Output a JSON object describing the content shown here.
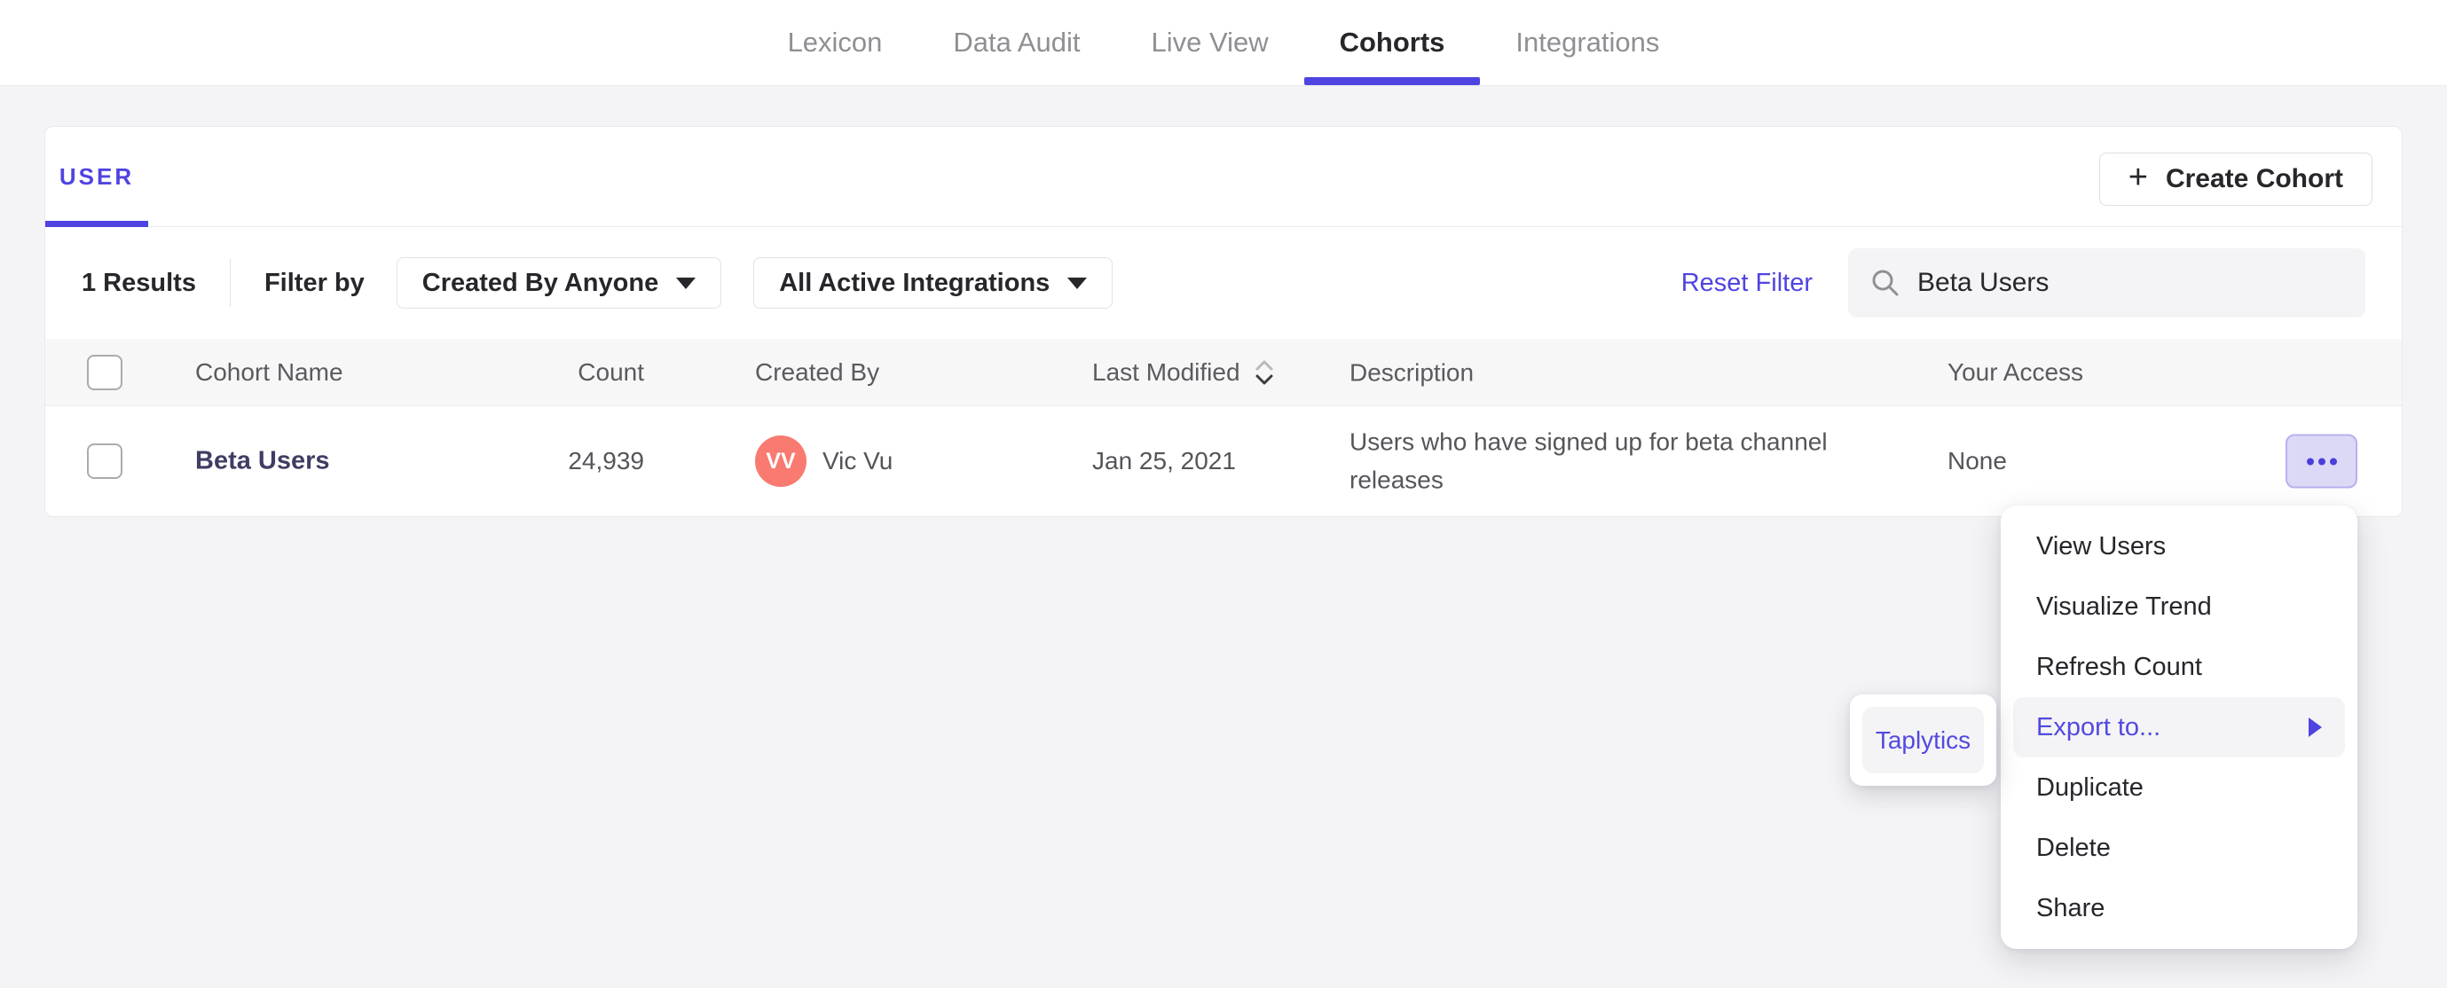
{
  "nav": {
    "items": [
      {
        "label": "Lexicon"
      },
      {
        "label": "Data Audit"
      },
      {
        "label": "Live View"
      },
      {
        "label": "Cohorts"
      },
      {
        "label": "Integrations"
      }
    ],
    "active": "Cohorts"
  },
  "panel": {
    "tab_label": "USER",
    "create_cohort": {
      "icon": "+",
      "label": "Create Cohort"
    },
    "filter_bar": {
      "results_count": "1 Results",
      "filter_by_label": "Filter by",
      "created_by_dropdown": "Created By Anyone",
      "integrations_dropdown": "All Active Integrations",
      "reset_filter": "Reset Filter",
      "search_value": "Beta Users"
    },
    "table": {
      "columns": {
        "cohort_name": "Cohort Name",
        "count": "Count",
        "created_by": "Created By",
        "last_modified": "Last Modified",
        "description": "Description",
        "your_access": "Your Access"
      },
      "row": {
        "name": "Beta Users",
        "count": "24,939",
        "creator_initials": "VV",
        "creator_name": "Vic Vu",
        "last_modified": "Jan 25, 2021",
        "description": "Users who have signed up for beta channel releases",
        "access": "None"
      }
    }
  },
  "context_menu": {
    "items": [
      {
        "label": "View Users"
      },
      {
        "label": "Visualize Trend"
      },
      {
        "label": "Refresh Count"
      },
      {
        "label": "Export to...",
        "highlighted": true,
        "has_submenu": true
      },
      {
        "label": "Duplicate"
      },
      {
        "label": "Delete"
      },
      {
        "label": "Share"
      }
    ]
  },
  "submenu": {
    "items": [
      {
        "label": "Taplytics"
      }
    ]
  },
  "colors": {
    "accent": "#4f44e0",
    "avatar": "#f87a71",
    "menu_highlight": "#f4f4f6",
    "page_bg": "#f4f3f5"
  }
}
